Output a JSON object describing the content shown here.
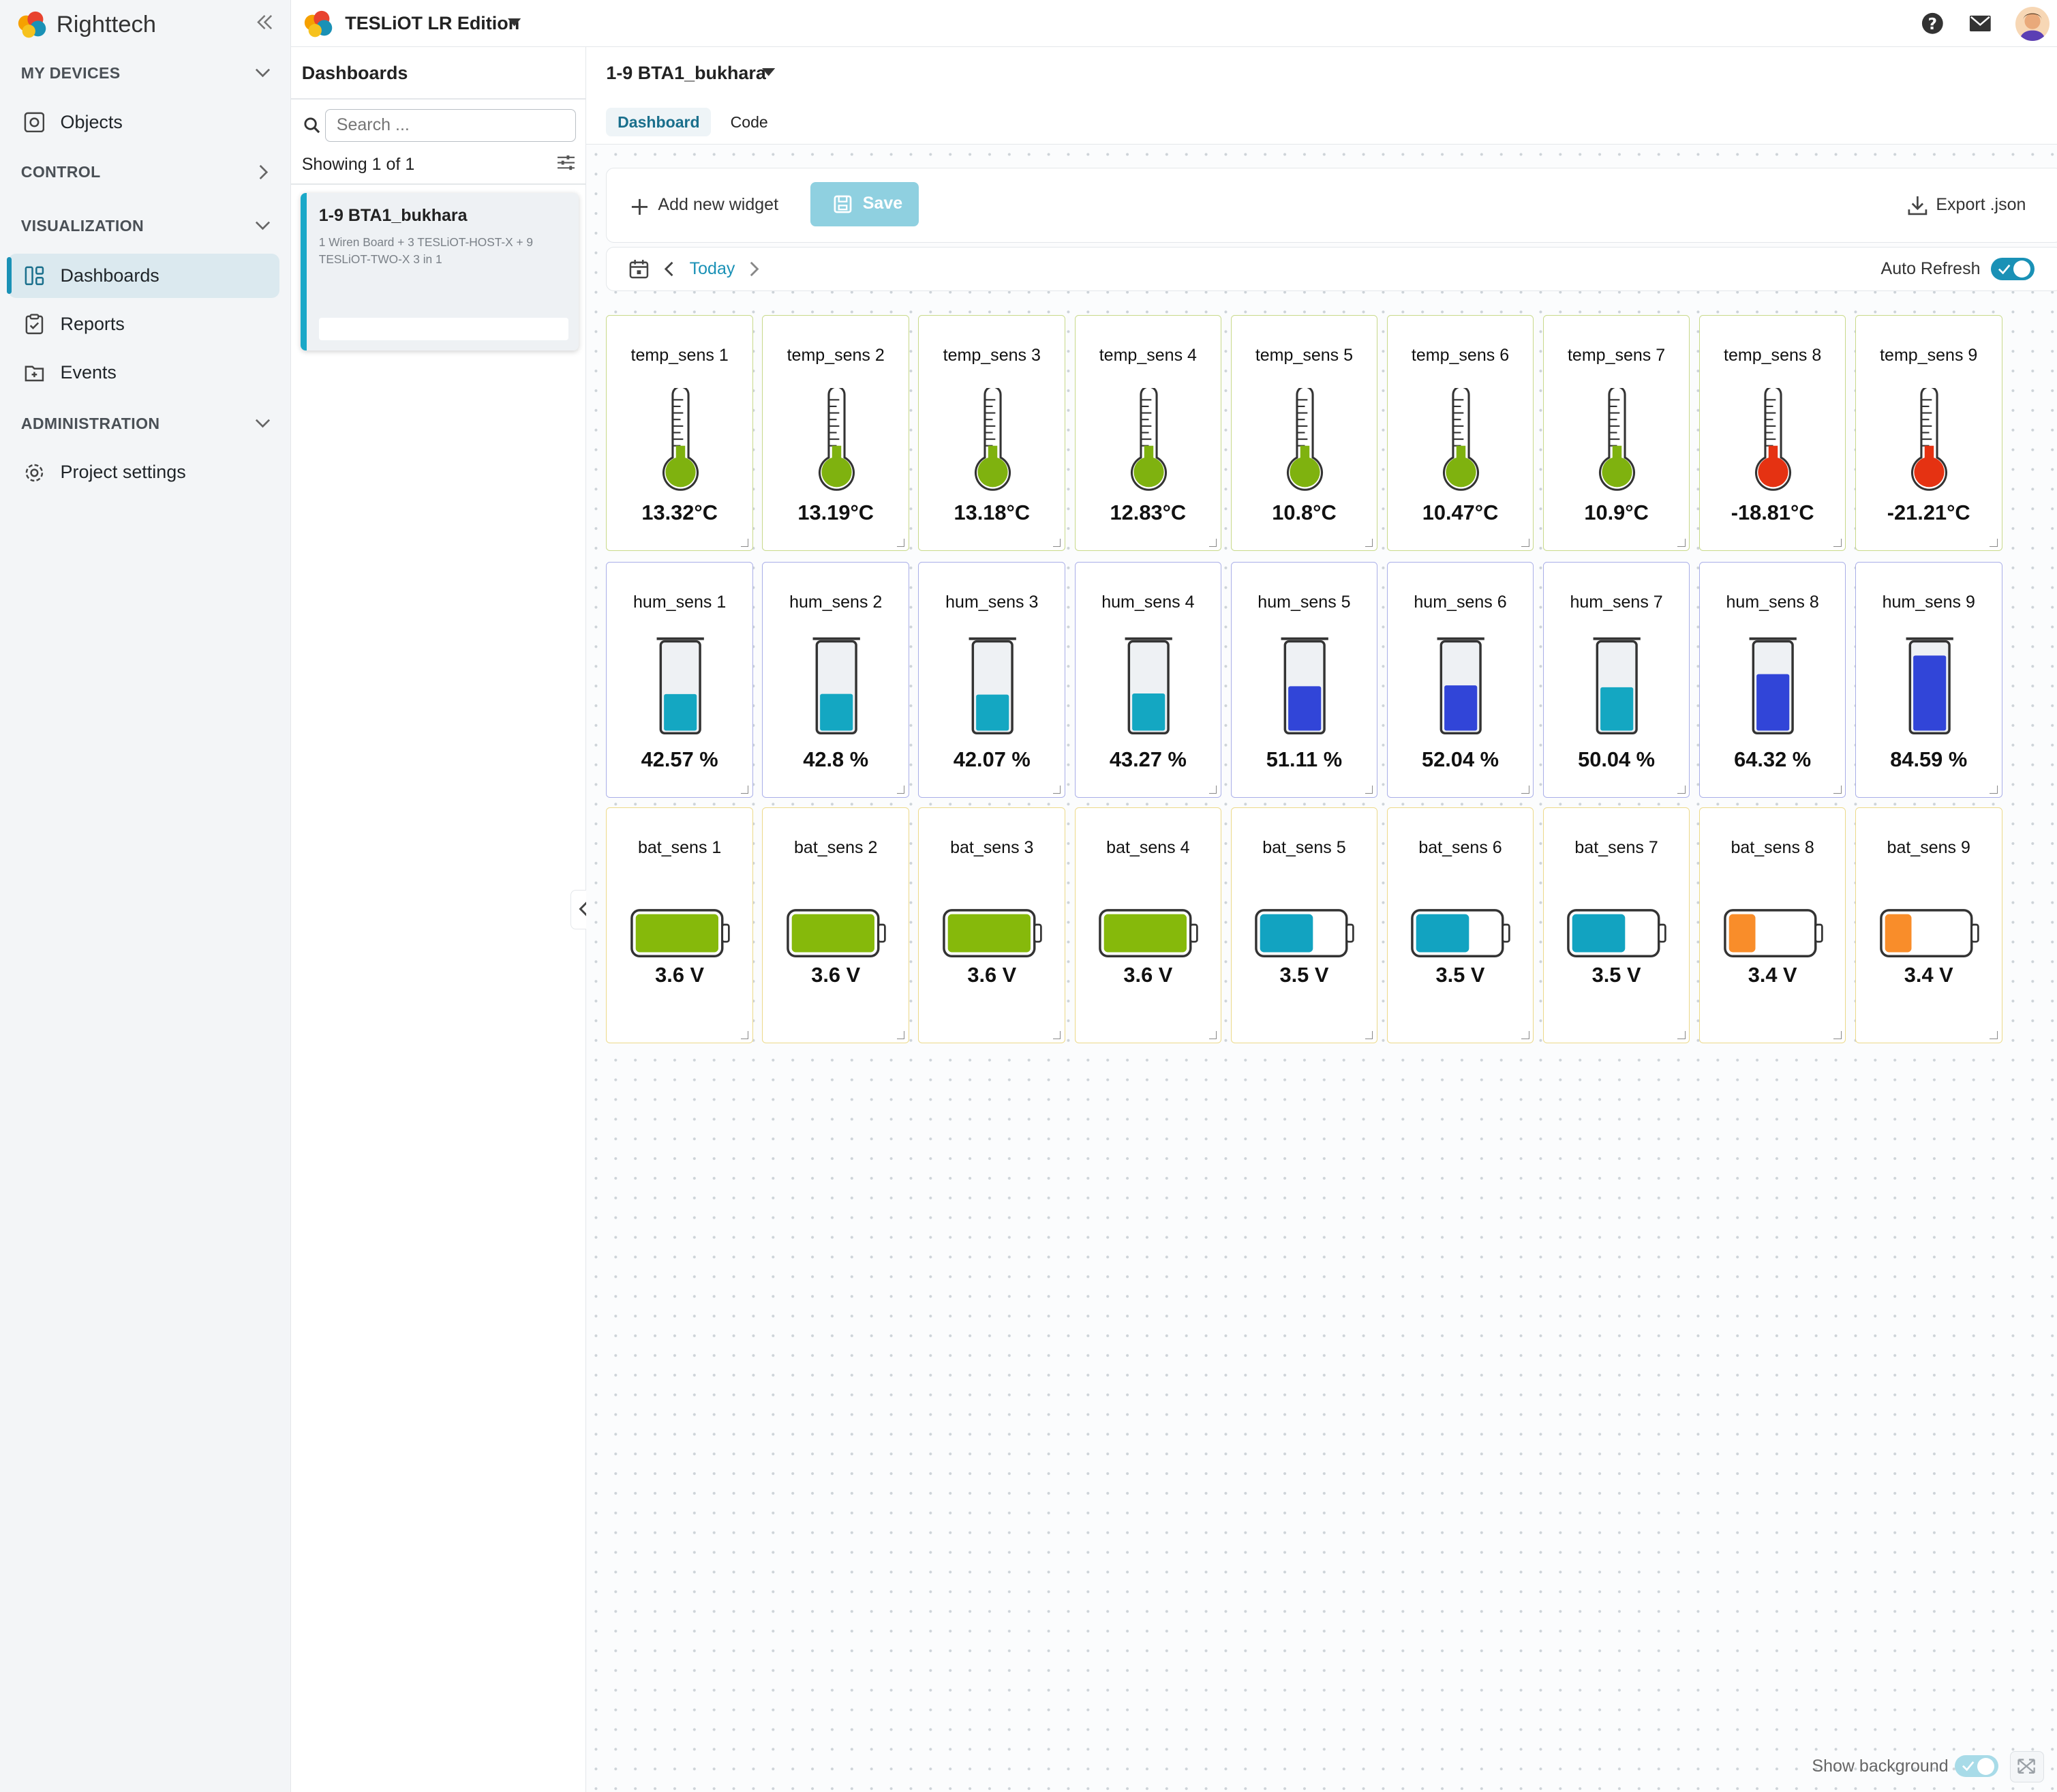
{
  "brand": "Righttech",
  "project": {
    "name": "TESLiOT LR Edition"
  },
  "sidebar": {
    "my_devices": "MY DEVICES",
    "objects": "Objects",
    "control": "CONTROL",
    "visualization": "VISUALIZATION",
    "dashboards": "Dashboards",
    "reports": "Reports",
    "events": "Events",
    "administration": "ADMINISTRATION",
    "project_settings": "Project settings"
  },
  "panel": {
    "title": "Dashboards",
    "search_placeholder": "Search ...",
    "showing": "Showing 1 of 1",
    "item": {
      "name": "1-9 BTA1_bukhara",
      "desc": "1 Wiren Board + 3 TESLiOT-HOST-X + 9 TESLiOT-TWO-X 3 in 1"
    }
  },
  "main": {
    "dashboard_name": "1-9 BTA1_bukhara",
    "tabs": [
      "Dashboard",
      "Code"
    ],
    "add_widget": "Add new widget",
    "save": "Save",
    "export": "Export .json",
    "today": "Today",
    "auto_refresh": "Auto Refresh",
    "show_background": "Show background"
  },
  "widgets": {
    "temp": [
      {
        "label": "temp_sens 1",
        "value": "13.32°C",
        "status": "ok"
      },
      {
        "label": "temp_sens 2",
        "value": "13.19°C",
        "status": "ok"
      },
      {
        "label": "temp_sens 3",
        "value": "13.18°C",
        "status": "ok"
      },
      {
        "label": "temp_sens 4",
        "value": "12.83°C",
        "status": "ok"
      },
      {
        "label": "temp_sens 5",
        "value": "10.8°C",
        "status": "ok"
      },
      {
        "label": "temp_sens 6",
        "value": "10.47°C",
        "status": "ok"
      },
      {
        "label": "temp_sens 7",
        "value": "10.9°C",
        "status": "ok"
      },
      {
        "label": "temp_sens 8",
        "value": "-18.81°C",
        "status": "alarm"
      },
      {
        "label": "temp_sens 9",
        "value": "-21.21°C",
        "status": "alarm"
      }
    ],
    "hum": [
      {
        "label": "hum_sens 1",
        "value": "42.57 %",
        "level": 42.57
      },
      {
        "label": "hum_sens 2",
        "value": "42.8 %",
        "level": 42.8
      },
      {
        "label": "hum_sens 3",
        "value": "42.07 %",
        "level": 42.07
      },
      {
        "label": "hum_sens 4",
        "value": "43.27 %",
        "level": 43.27
      },
      {
        "label": "hum_sens 5",
        "value": "51.11 %",
        "level": 51.11
      },
      {
        "label": "hum_sens 6",
        "value": "52.04 %",
        "level": 52.04
      },
      {
        "label": "hum_sens 7",
        "value": "50.04 %",
        "level": 50.04
      },
      {
        "label": "hum_sens 8",
        "value": "64.32 %",
        "level": 64.32
      },
      {
        "label": "hum_sens 9",
        "value": "84.59 %",
        "level": 84.59
      }
    ],
    "bat": [
      {
        "label": "bat_sens 1",
        "value": "3.6 V",
        "level": 1.0
      },
      {
        "label": "bat_sens 2",
        "value": "3.6 V",
        "level": 1.0
      },
      {
        "label": "bat_sens 3",
        "value": "3.6 V",
        "level": 1.0
      },
      {
        "label": "bat_sens 4",
        "value": "3.6 V",
        "level": 1.0
      },
      {
        "label": "bat_sens 5",
        "value": "3.5 V",
        "level": 0.64
      },
      {
        "label": "bat_sens 6",
        "value": "3.5 V",
        "level": 0.64
      },
      {
        "label": "bat_sens 7",
        "value": "3.5 V",
        "level": 0.64
      },
      {
        "label": "bat_sens 8",
        "value": "3.4 V",
        "level": 0.32
      },
      {
        "label": "bat_sens 9",
        "value": "3.4 V",
        "level": 0.32
      }
    ]
  },
  "colors": {
    "accent": "#1a91b6",
    "temp_ok": "#7fb20f",
    "temp_alarm": "#e53212",
    "hum_teal": "#14a7c2",
    "hum_blue": "#3145d8",
    "bat_green": "#86b90b",
    "bat_teal": "#12a3c1",
    "bat_orange": "#f98d2a"
  }
}
